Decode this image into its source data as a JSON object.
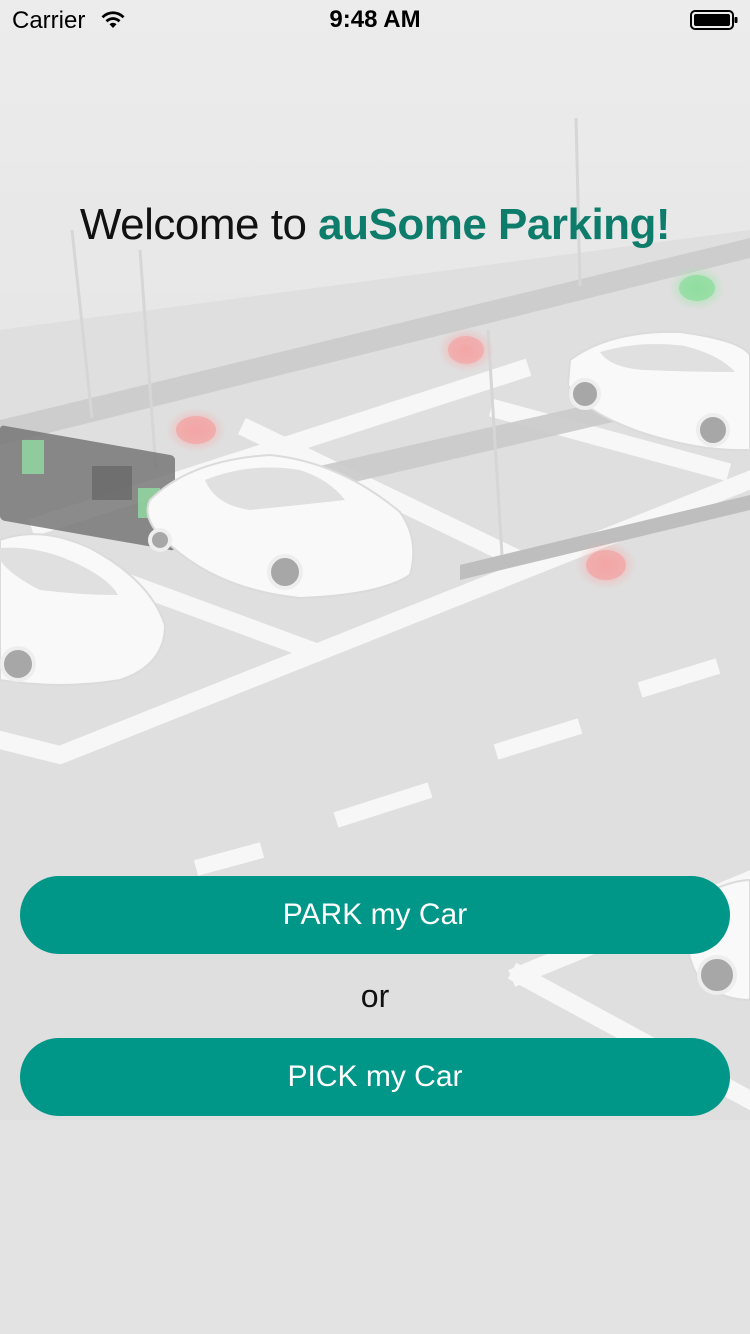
{
  "status_bar": {
    "carrier": "Carrier",
    "time": "9:48 AM",
    "icons": [
      "wifi-icon",
      "battery-icon"
    ]
  },
  "welcome": {
    "prefix": "Welcome to ",
    "brand": "auSome Parking!"
  },
  "actions": {
    "park_label": "PARK my Car",
    "separator": "or",
    "pick_label": "PICK my Car"
  },
  "colors": {
    "accent": "#009688",
    "brand_text": "#0d7c6b",
    "button_text": "#ffffff"
  }
}
